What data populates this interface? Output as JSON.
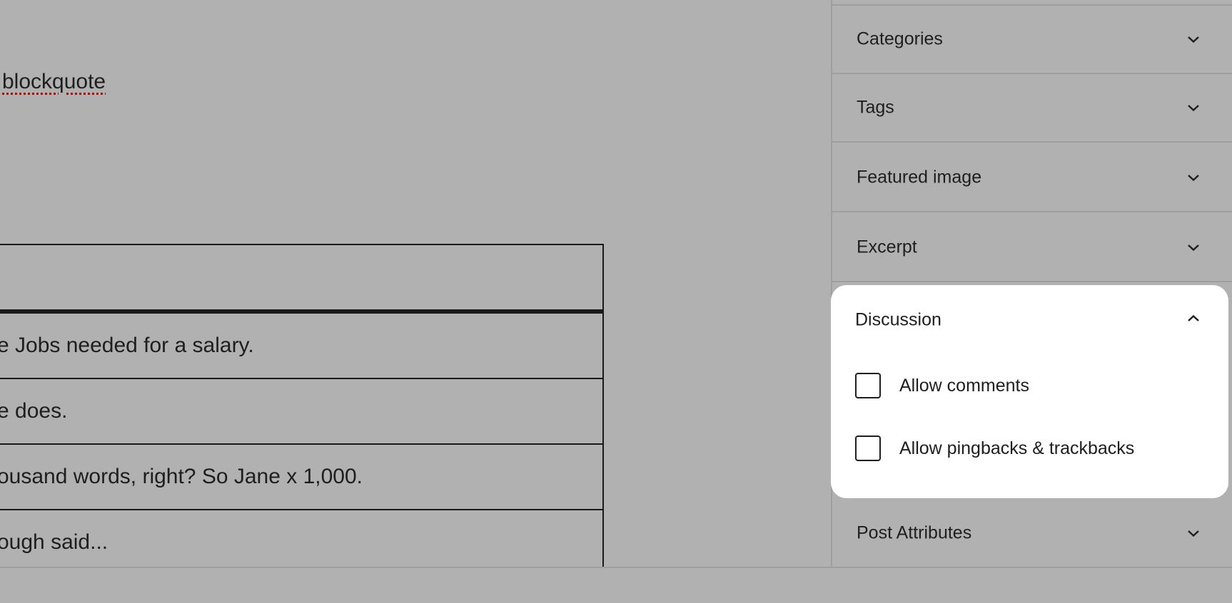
{
  "editor": {
    "blockquote_fragment": "blockquote",
    "table": {
      "header": [
        ""
      ],
      "rows": [
        "e Jobs needed for a salary.",
        "e does.",
        "ousand words, right? So Jane x 1,000.",
        "ough said..."
      ]
    }
  },
  "sidebar": {
    "panels": [
      {
        "label": "Categories",
        "expanded": false,
        "icon": "chevron-down-icon"
      },
      {
        "label": "Tags",
        "expanded": false,
        "icon": "chevron-down-icon"
      },
      {
        "label": "Featured image",
        "expanded": false,
        "icon": "chevron-down-icon"
      },
      {
        "label": "Excerpt",
        "expanded": false,
        "icon": "chevron-down-icon"
      }
    ],
    "discussion": {
      "label": "Discussion",
      "expanded": true,
      "icon": "chevron-up-icon",
      "options": [
        {
          "label": "Allow comments",
          "checked": false
        },
        {
          "label": "Allow pingbacks & trackbacks",
          "checked": false
        }
      ]
    },
    "post_attributes": {
      "label": "Post Attributes",
      "expanded": false,
      "icon": "chevron-down-icon"
    }
  },
  "colors": {
    "overlay_background": "#b1b1b1",
    "card_background": "#ffffff",
    "text": "#1e1e1e",
    "spellcheck_underline": "#c00000",
    "divider": "#9e9e9e"
  }
}
